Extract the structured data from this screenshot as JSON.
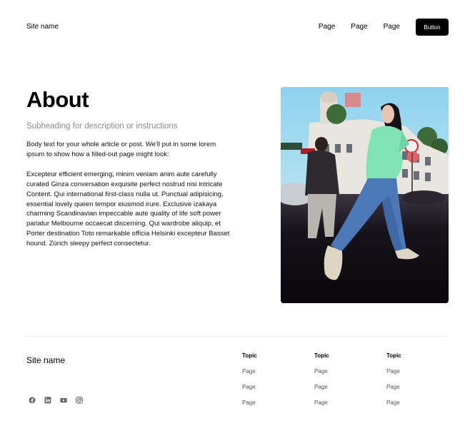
{
  "header": {
    "site_name": "Site name",
    "nav": [
      "Page",
      "Page",
      "Page"
    ],
    "button_label": "Button"
  },
  "main": {
    "title": "About",
    "subheading": "Subheading for description or instructions",
    "paragraphs": [
      "Body text for your whole article or post. We'll put in some lorem ipsum to show how a filled-out page might look:",
      "Excepteur efficient emerging, minim veniam anim aute carefully curated Ginza conversation exquisite perfect nostrud nisi intricate Content. Qui  international first-class nulla ut. Punctual adipisicing, essential lovely queen tempor eiusmod irure. Exclusive izakaya charming Scandinavian impeccable aute quality of life soft power pariatur Melbourne occaecat discerning. Qui wardrobe aliquip, et Porter destination Toto remarkable officia Helsinki excepteur Basset hound. Zürich sleepy perfect consectetur."
    ],
    "hero_image_icon": "photo-woman-walking-street"
  },
  "footer": {
    "site_name": "Site name",
    "socials": [
      "facebook-icon",
      "linkedin-icon",
      "youtube-icon",
      "instagram-icon"
    ],
    "columns": [
      {
        "topic": "Topic",
        "links": [
          "Page",
          "Page",
          "Page"
        ]
      },
      {
        "topic": "Topic",
        "links": [
          "Page",
          "Page",
          "Page"
        ]
      },
      {
        "topic": "Topic",
        "links": [
          "Page",
          "Page",
          "Page"
        ]
      }
    ]
  },
  "colors": {
    "button_bg": "#000000",
    "subheading": "#8a8a8a",
    "divider": "#ededed"
  }
}
